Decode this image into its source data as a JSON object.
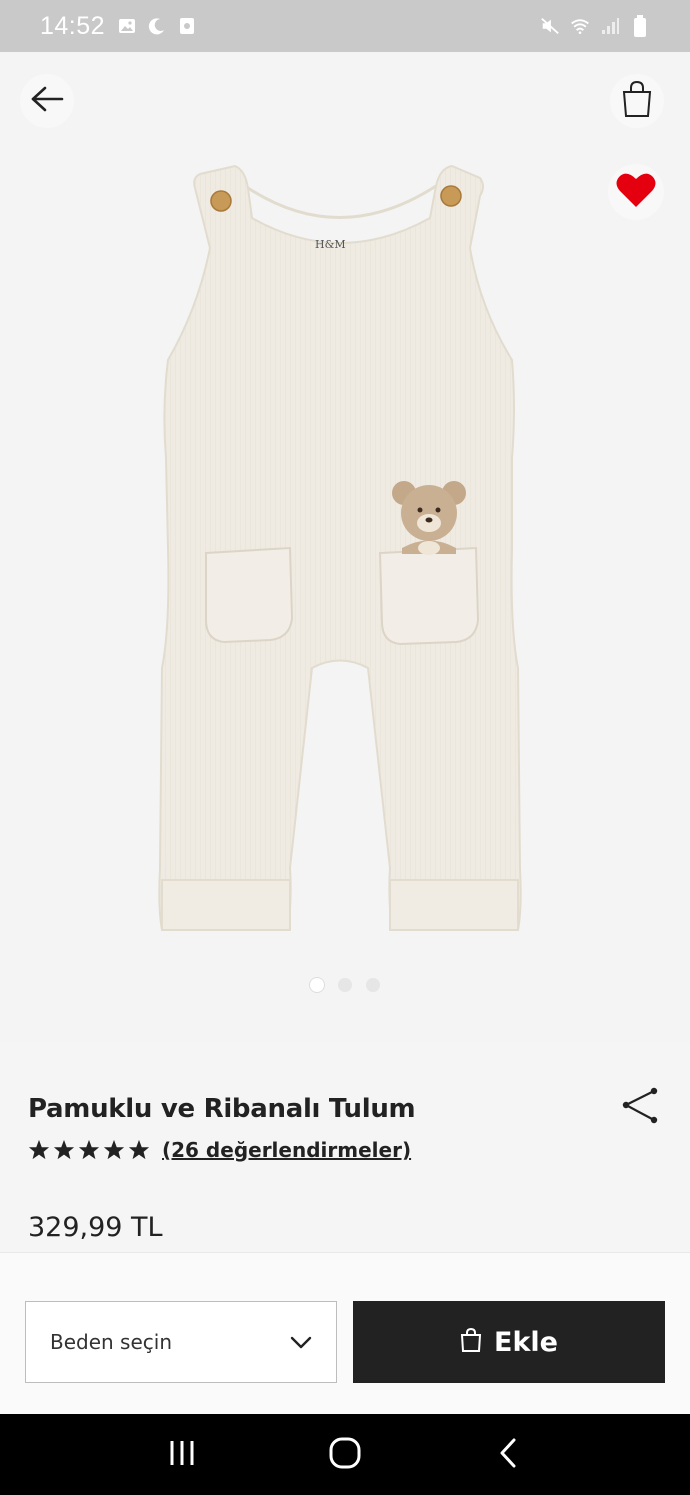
{
  "status_bar": {
    "time": "14:52",
    "left_icons": [
      "image-icon",
      "moon-icon",
      "app-notification-icon"
    ],
    "right_icons": [
      "mute-icon",
      "wifi-icon",
      "signal-icon",
      "battery-icon"
    ]
  },
  "header": {
    "back_icon": "arrow-left-icon",
    "bag_icon": "shopping-bag-icon",
    "favorite_icon": "heart-icon",
    "favorite_color": "#e50010"
  },
  "gallery": {
    "image_alt": "cream ribbed cotton dungarees with bear pocket",
    "logo_text": "H&M",
    "slide_count": 3,
    "active_slide": 1
  },
  "product": {
    "title": "Pamuklu ve Ribanalı Tulum",
    "rating_stars": 5,
    "reviews_link": "(26 değerlendirmeler)",
    "price": "329,99 TL",
    "share_icon": "share-icon"
  },
  "actions": {
    "size_placeholder": "Beden seçin",
    "add_label": "Ekle",
    "add_icon": "shopping-bag-icon",
    "add_bg": "#222222"
  },
  "nav": {
    "recent_icon": "recent-apps-icon",
    "home_icon": "home-icon",
    "back_icon": "back-chevron-icon"
  }
}
